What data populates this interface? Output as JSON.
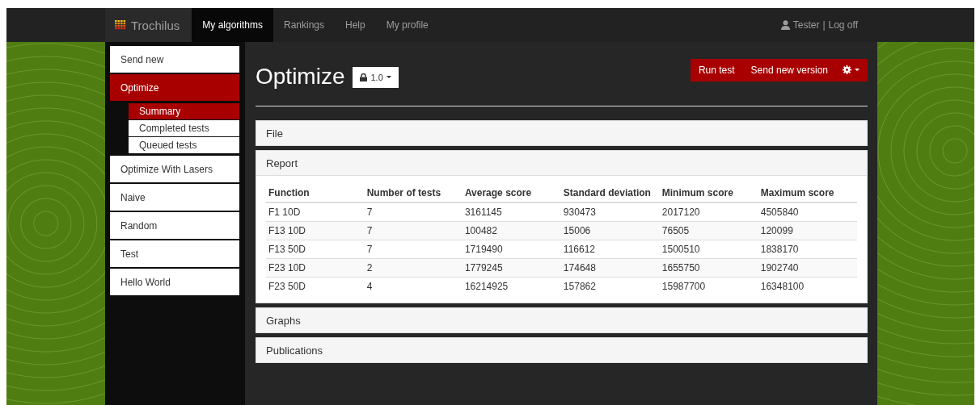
{
  "nav": {
    "brand": "Trochilus",
    "items": [
      {
        "label": "My algorithms",
        "selected": true
      },
      {
        "label": "Rankings",
        "selected": false
      },
      {
        "label": "Help",
        "selected": false
      },
      {
        "label": "My profile",
        "selected": false
      }
    ],
    "user": "Tester",
    "separator": "|",
    "logoff": "Log off"
  },
  "sidebar": {
    "items": [
      {
        "label": "Send new",
        "selected": false
      },
      {
        "label": "Optimize",
        "selected": true,
        "children": [
          {
            "label": "Summary",
            "selected": true
          },
          {
            "label": "Completed tests",
            "selected": false
          },
          {
            "label": "Queued tests",
            "selected": false
          }
        ]
      },
      {
        "label": "Optimize With Lasers",
        "selected": false
      },
      {
        "label": "Naive",
        "selected": false
      },
      {
        "label": "Random",
        "selected": false
      },
      {
        "label": "Test",
        "selected": false
      },
      {
        "label": "Hello World",
        "selected": false
      }
    ]
  },
  "page": {
    "title": "Optimize",
    "version": "1.0",
    "actions": [
      "Run test",
      "Send new version"
    ]
  },
  "panels": [
    {
      "title": "File"
    },
    {
      "title": "Report",
      "table": {
        "columns": [
          "Function",
          "Number of tests",
          "Average score",
          "Standard deviation",
          "Minimum score",
          "Maximum score"
        ],
        "rows": [
          [
            "F1 10D",
            "7",
            "3161145",
            "930473",
            "2017120",
            "4505840"
          ],
          [
            "F13 10D",
            "7",
            "100482",
            "15006",
            "76505",
            "120099"
          ],
          [
            "F13 50D",
            "7",
            "1719490",
            "116612",
            "1500510",
            "1838170"
          ],
          [
            "F23 10D",
            "2",
            "1779245",
            "174648",
            "1655750",
            "1902740"
          ],
          [
            "F23 50D",
            "4",
            "16214925",
            "157862",
            "15987700",
            "16348100"
          ]
        ]
      }
    },
    {
      "title": "Graphs"
    },
    {
      "title": "Publications"
    }
  ]
}
